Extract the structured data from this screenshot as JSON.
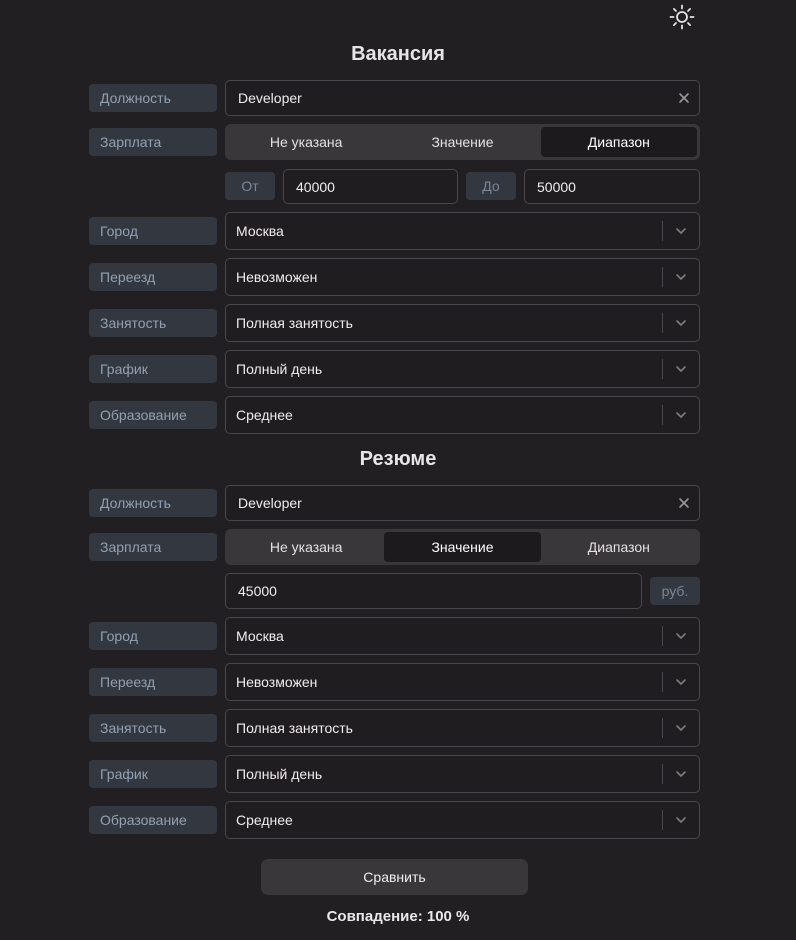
{
  "vacancy": {
    "title": "Вакансия",
    "position": {
      "label": "Должность",
      "value": "Developer"
    },
    "salary": {
      "label": "Зарплата",
      "options": [
        "Не указана",
        "Значение",
        "Диапазон"
      ],
      "selected": "Диапазон",
      "from_label": "От",
      "from_value": "40000",
      "to_label": "До",
      "to_value": "50000"
    },
    "city": {
      "label": "Город",
      "value": "Москва"
    },
    "relocation": {
      "label": "Переезд",
      "value": "Невозможен"
    },
    "employment": {
      "label": "Занятость",
      "value": "Полная занятость"
    },
    "schedule": {
      "label": "График",
      "value": "Полный день"
    },
    "education": {
      "label": "Образование",
      "value": "Среднее"
    }
  },
  "resume": {
    "title": "Резюме",
    "position": {
      "label": "Должность",
      "value": "Developer"
    },
    "salary": {
      "label": "Зарплата",
      "options": [
        "Не указана",
        "Значение",
        "Диапазон"
      ],
      "selected": "Значение",
      "value": "45000",
      "currency": "руб."
    },
    "city": {
      "label": "Город",
      "value": "Москва"
    },
    "relocation": {
      "label": "Переезд",
      "value": "Невозможен"
    },
    "employment": {
      "label": "Занятость",
      "value": "Полная занятость"
    },
    "schedule": {
      "label": "График",
      "value": "Полный день"
    },
    "education": {
      "label": "Образование",
      "value": "Среднее"
    }
  },
  "actions": {
    "compare_label": "Сравнить"
  },
  "result": {
    "match_text": "Совпадение: 100 %"
  },
  "icons": {
    "theme": "sun-icon",
    "clear": "close-icon",
    "select": "chevron-down-icon"
  }
}
